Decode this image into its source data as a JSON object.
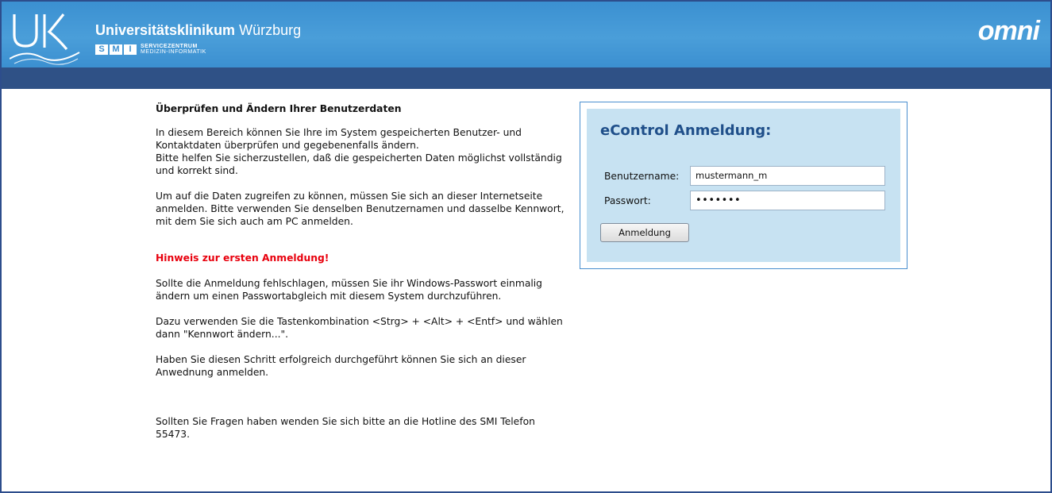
{
  "header": {
    "logo_text": "U|K",
    "title_bold": "Universitätsklinikum",
    "title_light": "Würzburg",
    "smi_letters": [
      "S",
      "M",
      "I"
    ],
    "smi_line1": "SERVICEZENTRUM",
    "smi_line2": "MEDIZIN-INFORMATIK",
    "omni_logo": "omni"
  },
  "content": {
    "heading": "Überprüfen und Ändern Ihrer Benutzerdaten",
    "para1": "In diesem Bereich können Sie Ihre im System gespeicherten Benutzer- und Kontaktdaten überprüfen und gegebenenfalls ändern.",
    "para1b": "Bitte helfen Sie sicherzustellen, daß die gespeicherten Daten möglichst vollständig und korrekt sind.",
    "para2": "Um auf die Daten zugreifen zu können, müssen Sie sich an dieser Internetseite anmelden. Bitte verwenden Sie denselben Benutzernamen und dasselbe Kennwort, mit dem Sie sich auch am PC anmelden.",
    "warning": "Hinweis zur ersten Anmeldung!",
    "para3": "Sollte die Anmeldung fehlschlagen, müssen Sie ihr Windows-Passwort einmalig ändern um einen Passwortabgleich mit diesem System durchzuführen.",
    "para4": "Dazu verwenden Sie die Tastenkombination <Strg> + <Alt> + <Entf> und wählen dann \"Kennwort ändern...\".",
    "para5": "Haben Sie diesen Schritt erfolgreich durchgeführt können Sie sich an dieser Anwednung anmelden.",
    "para6": "Sollten Sie Fragen haben wenden Sie sich bitte an die Hotline des SMI Telefon 55473."
  },
  "login": {
    "title": "eControl Anmeldung:",
    "username_label": "Benutzername:",
    "username_value": "mustermann_m",
    "password_label": "Passwort:",
    "password_value": "•••••••",
    "submit_label": "Anmeldung"
  },
  "colors": {
    "header_blue": "#4a9ed9",
    "nav_blue": "#2f5186",
    "login_bg": "#c7e2f2",
    "warning_red": "#e8000d"
  }
}
